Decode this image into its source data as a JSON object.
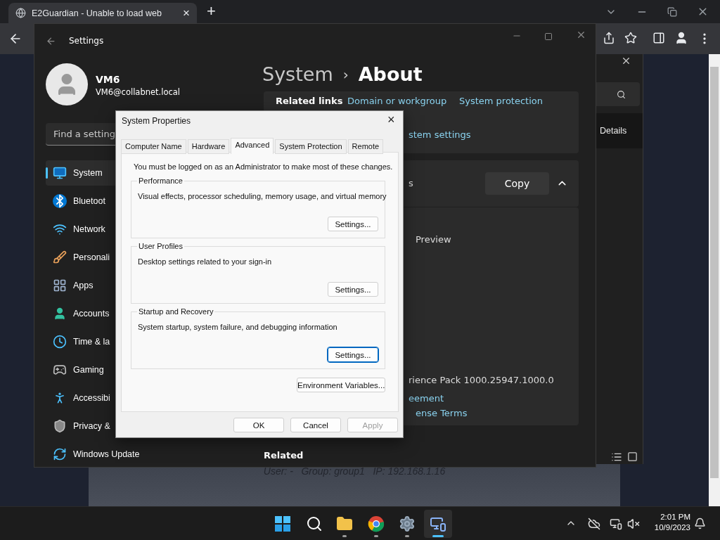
{
  "browser": {
    "tab": {
      "title": "E2Guardian - Unable to load web",
      "close": "×"
    },
    "new_tab": "+"
  },
  "page": {
    "footer": "User: -   Group: group1   IP: 192.168.1.16"
  },
  "back_window": {
    "details": "Details"
  },
  "settings": {
    "title": "Settings",
    "user": {
      "name": "VM6",
      "email": "VM6@collabnet.local"
    },
    "search": {
      "placeholder": "Find a setting"
    },
    "nav": [
      {
        "label": "System",
        "selected": true
      },
      {
        "label": "Bluetoot",
        "selected": false
      },
      {
        "label": "Network",
        "selected": false
      },
      {
        "label": "Personali",
        "selected": false
      },
      {
        "label": "Apps",
        "selected": false
      },
      {
        "label": "Accounts",
        "selected": false
      },
      {
        "label": "Time & la",
        "selected": false
      },
      {
        "label": "Gaming",
        "selected": false
      },
      {
        "label": "Accessibi",
        "selected": false
      },
      {
        "label": "Privacy &",
        "selected": false
      },
      {
        "label": "Windows Update",
        "selected": false
      }
    ],
    "breadcrumb": {
      "parent": "System",
      "separator": "›",
      "current": "About"
    },
    "related_links": {
      "label": "Related links",
      "links": [
        "Domain or workgroup",
        "System protection"
      ],
      "second_line": "stem settings"
    },
    "spec_card": {
      "title": "s",
      "copy": "Copy",
      "expanded": true
    },
    "info": {
      "edition": "Preview",
      "pack": "rience Pack 1000.25947.1000.0",
      "links": [
        "eement",
        "ense Terms"
      ]
    },
    "related": "Related"
  },
  "dialog": {
    "title": "System Properties",
    "close": "×",
    "tabs": [
      {
        "label": "Computer Name",
        "selected": false
      },
      {
        "label": "Hardware",
        "selected": false
      },
      {
        "label": "Advanced",
        "selected": true
      },
      {
        "label": "System Protection",
        "selected": false
      },
      {
        "label": "Remote",
        "selected": false
      }
    ],
    "intro": "You must be logged on as an Administrator to make most of these changes.",
    "groups": [
      {
        "title": "Performance",
        "description": "Visual effects, processor scheduling, memory usage, and virtual memory",
        "button": "Settings...",
        "focused": false
      },
      {
        "title": "User Profiles",
        "description": "Desktop settings related to your sign-in",
        "button": "Settings...",
        "focused": false
      },
      {
        "title": "Startup and Recovery",
        "description": "System startup, system failure, and debugging information",
        "button": "Settings...",
        "focused": true
      }
    ],
    "env_button": "Environment Variables...",
    "buttons": [
      {
        "label": "OK",
        "disabled": false
      },
      {
        "label": "Cancel",
        "disabled": false
      },
      {
        "label": "Apply",
        "disabled": true
      }
    ]
  },
  "taskbar": {
    "apps": [
      {
        "running": false,
        "selected": false
      },
      {
        "running": false,
        "selected": false
      },
      {
        "running": true,
        "selected": false
      },
      {
        "running": true,
        "selected": false
      },
      {
        "running": true,
        "selected": false
      },
      {
        "running": true,
        "selected": true
      }
    ],
    "time": "2:01 PM",
    "date": "10/9/2023"
  }
}
